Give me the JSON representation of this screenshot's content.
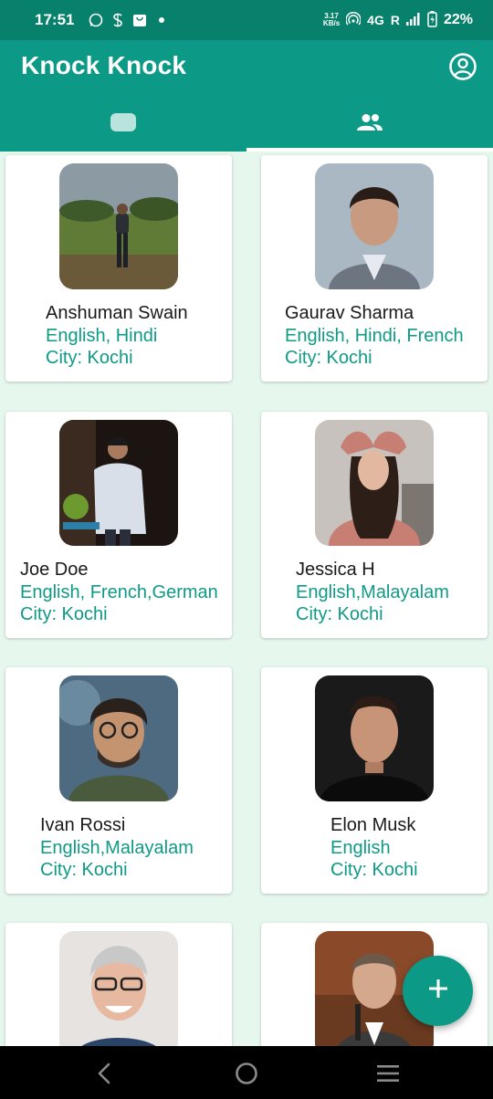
{
  "status_bar": {
    "time": "17:51",
    "net_speed_value": "3.17",
    "net_speed_unit": "KB/s",
    "network": "4G",
    "roaming": "R",
    "battery": "22%"
  },
  "app_bar": {
    "title": "Knock Knock",
    "account_icon": "account-circle-icon"
  },
  "tabs": [
    {
      "icon": "chat-bubble-icon",
      "selected": false
    },
    {
      "icon": "people-icon",
      "selected": true
    }
  ],
  "contacts": [
    {
      "name": "Anshuman Swain",
      "languages": "English, Hindi",
      "city": "City: Kochi"
    },
    {
      "name": "Gaurav Sharma",
      "languages": "English, Hindi, French",
      "city": "City: Kochi"
    },
    {
      "name": "Joe Doe",
      "languages": "English, French,German",
      "city": "City: Kochi"
    },
    {
      "name": "Jessica H",
      "languages": "English,Malayalam",
      "city": "City: Kochi"
    },
    {
      "name": "Ivan Rossi",
      "languages": "English,Malayalam",
      "city": "City: Kochi"
    },
    {
      "name": "Elon Musk",
      "languages": "English",
      "city": "City: Kochi"
    },
    {
      "name": "",
      "languages": "",
      "city": ""
    },
    {
      "name": "",
      "languages": "",
      "city": ""
    }
  ],
  "fab": {
    "icon": "add-icon"
  },
  "colors": {
    "status_bar": "#07806c",
    "primary": "#0c9a86",
    "accent_text": "#0f9a86",
    "background": "#e6f7ee"
  },
  "nav_bar": {
    "back": "back-icon",
    "home": "home-icon",
    "recents": "recents-icon"
  }
}
